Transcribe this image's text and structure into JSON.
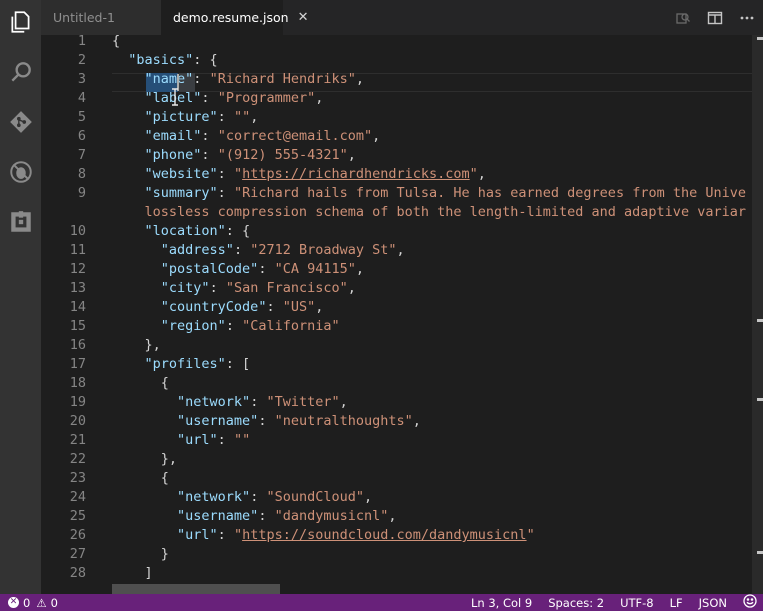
{
  "tabs": [
    {
      "label": "Untitled-1",
      "active": false
    },
    {
      "label": "demo.resume.json",
      "active": true
    }
  ],
  "tab_actions": [
    "open-preview-icon",
    "split-editor-icon",
    "more-icon"
  ],
  "activity_bar": [
    "files-icon",
    "search-icon",
    "git-icon",
    "debug-icon",
    "extensions-icon"
  ],
  "editor": {
    "lines": [
      {
        "n": "1",
        "t": [
          [
            "p",
            "{"
          ]
        ]
      },
      {
        "n": "2",
        "t": [
          [
            "p",
            "  "
          ],
          [
            "k",
            "\"basics\""
          ],
          [
            "p",
            ": {"
          ]
        ]
      },
      {
        "n": "3",
        "t": [
          [
            "p",
            "    "
          ],
          [
            "k",
            "\"name\""
          ],
          [
            "p",
            ": "
          ],
          [
            "s",
            "\"Richard Hendriks\""
          ],
          [
            "p",
            ","
          ]
        ]
      },
      {
        "n": "4",
        "t": [
          [
            "p",
            "    "
          ],
          [
            "k",
            "\"label\""
          ],
          [
            "p",
            ": "
          ],
          [
            "s",
            "\"Programmer\""
          ],
          [
            "p",
            ","
          ]
        ]
      },
      {
        "n": "5",
        "t": [
          [
            "p",
            "    "
          ],
          [
            "k",
            "\"picture\""
          ],
          [
            "p",
            ": "
          ],
          [
            "s",
            "\"\""
          ],
          [
            "p",
            ","
          ]
        ]
      },
      {
        "n": "6",
        "t": [
          [
            "p",
            "    "
          ],
          [
            "k",
            "\"email\""
          ],
          [
            "p",
            ": "
          ],
          [
            "s",
            "\"correct@email.com\""
          ],
          [
            "p",
            ","
          ]
        ]
      },
      {
        "n": "7",
        "t": [
          [
            "p",
            "    "
          ],
          [
            "k",
            "\"phone\""
          ],
          [
            "p",
            ": "
          ],
          [
            "s",
            "\"(912) 555-4321\""
          ],
          [
            "p",
            ","
          ]
        ]
      },
      {
        "n": "8",
        "t": [
          [
            "p",
            "    "
          ],
          [
            "k",
            "\"website\""
          ],
          [
            "p",
            ": "
          ],
          [
            "s",
            "\""
          ],
          [
            "u",
            "https://richardhendricks.com"
          ],
          [
            "s",
            "\""
          ],
          [
            "p",
            ","
          ]
        ]
      },
      {
        "n": "9",
        "t": [
          [
            "p",
            "    "
          ],
          [
            "k",
            "\"summary\""
          ],
          [
            "p",
            ": "
          ],
          [
            "s",
            "\"Richard hails from Tulsa. He has earned degrees from the Unive"
          ]
        ]
      },
      {
        "n": "",
        "t": [
          [
            "s",
            "    lossless compression schema of both the length-limited and adaptive variar"
          ]
        ]
      },
      {
        "n": "10",
        "t": [
          [
            "p",
            "    "
          ],
          [
            "k",
            "\"location\""
          ],
          [
            "p",
            ": {"
          ]
        ]
      },
      {
        "n": "11",
        "t": [
          [
            "p",
            "      "
          ],
          [
            "k",
            "\"address\""
          ],
          [
            "p",
            ": "
          ],
          [
            "s",
            "\"2712 Broadway St\""
          ],
          [
            "p",
            ","
          ]
        ]
      },
      {
        "n": "12",
        "t": [
          [
            "p",
            "      "
          ],
          [
            "k",
            "\"postalCode\""
          ],
          [
            "p",
            ": "
          ],
          [
            "s",
            "\"CA 94115\""
          ],
          [
            "p",
            ","
          ]
        ]
      },
      {
        "n": "13",
        "t": [
          [
            "p",
            "      "
          ],
          [
            "k",
            "\"city\""
          ],
          [
            "p",
            ": "
          ],
          [
            "s",
            "\"San Francisco\""
          ],
          [
            "p",
            ","
          ]
        ]
      },
      {
        "n": "14",
        "t": [
          [
            "p",
            "      "
          ],
          [
            "k",
            "\"countryCode\""
          ],
          [
            "p",
            ": "
          ],
          [
            "s",
            "\"US\""
          ],
          [
            "p",
            ","
          ]
        ]
      },
      {
        "n": "15",
        "t": [
          [
            "p",
            "      "
          ],
          [
            "k",
            "\"region\""
          ],
          [
            "p",
            ": "
          ],
          [
            "s",
            "\"California\""
          ]
        ]
      },
      {
        "n": "16",
        "t": [
          [
            "p",
            "    },"
          ]
        ]
      },
      {
        "n": "17",
        "t": [
          [
            "p",
            "    "
          ],
          [
            "k",
            "\"profiles\""
          ],
          [
            "p",
            ": ["
          ]
        ]
      },
      {
        "n": "18",
        "t": [
          [
            "p",
            "      {"
          ]
        ]
      },
      {
        "n": "19",
        "t": [
          [
            "p",
            "        "
          ],
          [
            "k",
            "\"network\""
          ],
          [
            "p",
            ": "
          ],
          [
            "s",
            "\"Twitter\""
          ],
          [
            "p",
            ","
          ]
        ]
      },
      {
        "n": "20",
        "t": [
          [
            "p",
            "        "
          ],
          [
            "k",
            "\"username\""
          ],
          [
            "p",
            ": "
          ],
          [
            "s",
            "\"neutralthoughts\""
          ],
          [
            "p",
            ","
          ]
        ]
      },
      {
        "n": "21",
        "t": [
          [
            "p",
            "        "
          ],
          [
            "k",
            "\"url\""
          ],
          [
            "p",
            ": "
          ],
          [
            "s",
            "\"\""
          ]
        ]
      },
      {
        "n": "22",
        "t": [
          [
            "p",
            "      },"
          ]
        ]
      },
      {
        "n": "23",
        "t": [
          [
            "p",
            "      {"
          ]
        ]
      },
      {
        "n": "24",
        "t": [
          [
            "p",
            "        "
          ],
          [
            "k",
            "\"network\""
          ],
          [
            "p",
            ": "
          ],
          [
            "s",
            "\"SoundCloud\""
          ],
          [
            "p",
            ","
          ]
        ]
      },
      {
        "n": "25",
        "t": [
          [
            "p",
            "        "
          ],
          [
            "k",
            "\"username\""
          ],
          [
            "p",
            ": "
          ],
          [
            "s",
            "\"dandymusicnl\""
          ],
          [
            "p",
            ","
          ]
        ]
      },
      {
        "n": "26",
        "t": [
          [
            "p",
            "        "
          ],
          [
            "k",
            "\"url\""
          ],
          [
            "p",
            ": "
          ],
          [
            "s",
            "\""
          ],
          [
            "u",
            "https://soundcloud.com/dandymusicnl"
          ],
          [
            "s",
            "\""
          ]
        ]
      },
      {
        "n": "27",
        "t": [
          [
            "p",
            "      }"
          ]
        ]
      },
      {
        "n": "28",
        "t": [
          [
            "p",
            "    ]"
          ]
        ]
      },
      {
        "n": "",
        "t": [
          [
            "p",
            "  }"
          ]
        ]
      }
    ]
  },
  "statusbar": {
    "errors": "0",
    "warnings": "0",
    "position": "Ln 3, Col 9",
    "spaces": "Spaces: 2",
    "encoding": "UTF-8",
    "eol": "LF",
    "language": "JSON"
  },
  "colors": {
    "activity_bg": "#333333",
    "statusbar_bg": "#68217a",
    "json_key": "#9cdcfe",
    "json_string": "#ce9178"
  }
}
